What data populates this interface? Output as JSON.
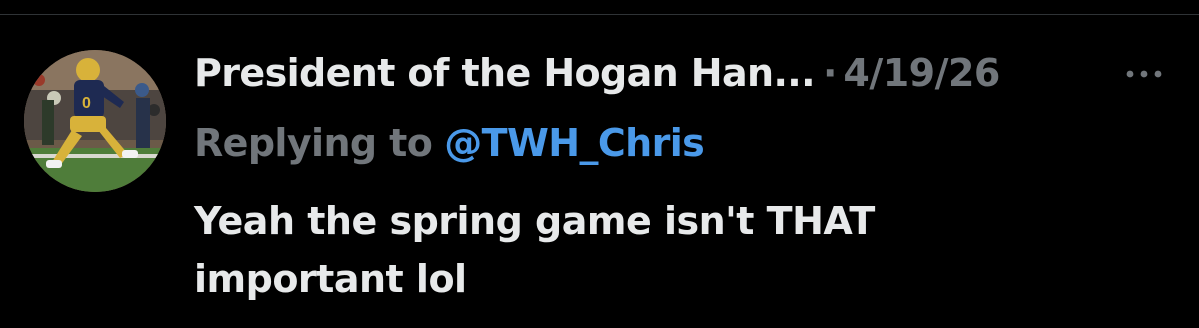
{
  "tweet": {
    "display_name": "President of the Hogan Han...",
    "separator": "·",
    "timestamp": "4/19/26",
    "more_icon": "more-horizontal-icon",
    "replying_label": "Replying to",
    "reply_to_handle": "@TWH_Chris",
    "text": "Yeah the spring game isn't THAT\nimportant lol"
  },
  "colors": {
    "background": "#000000",
    "primary_text": "#e7e9ea",
    "secondary_text": "#71767b",
    "link": "#4a99e9"
  }
}
